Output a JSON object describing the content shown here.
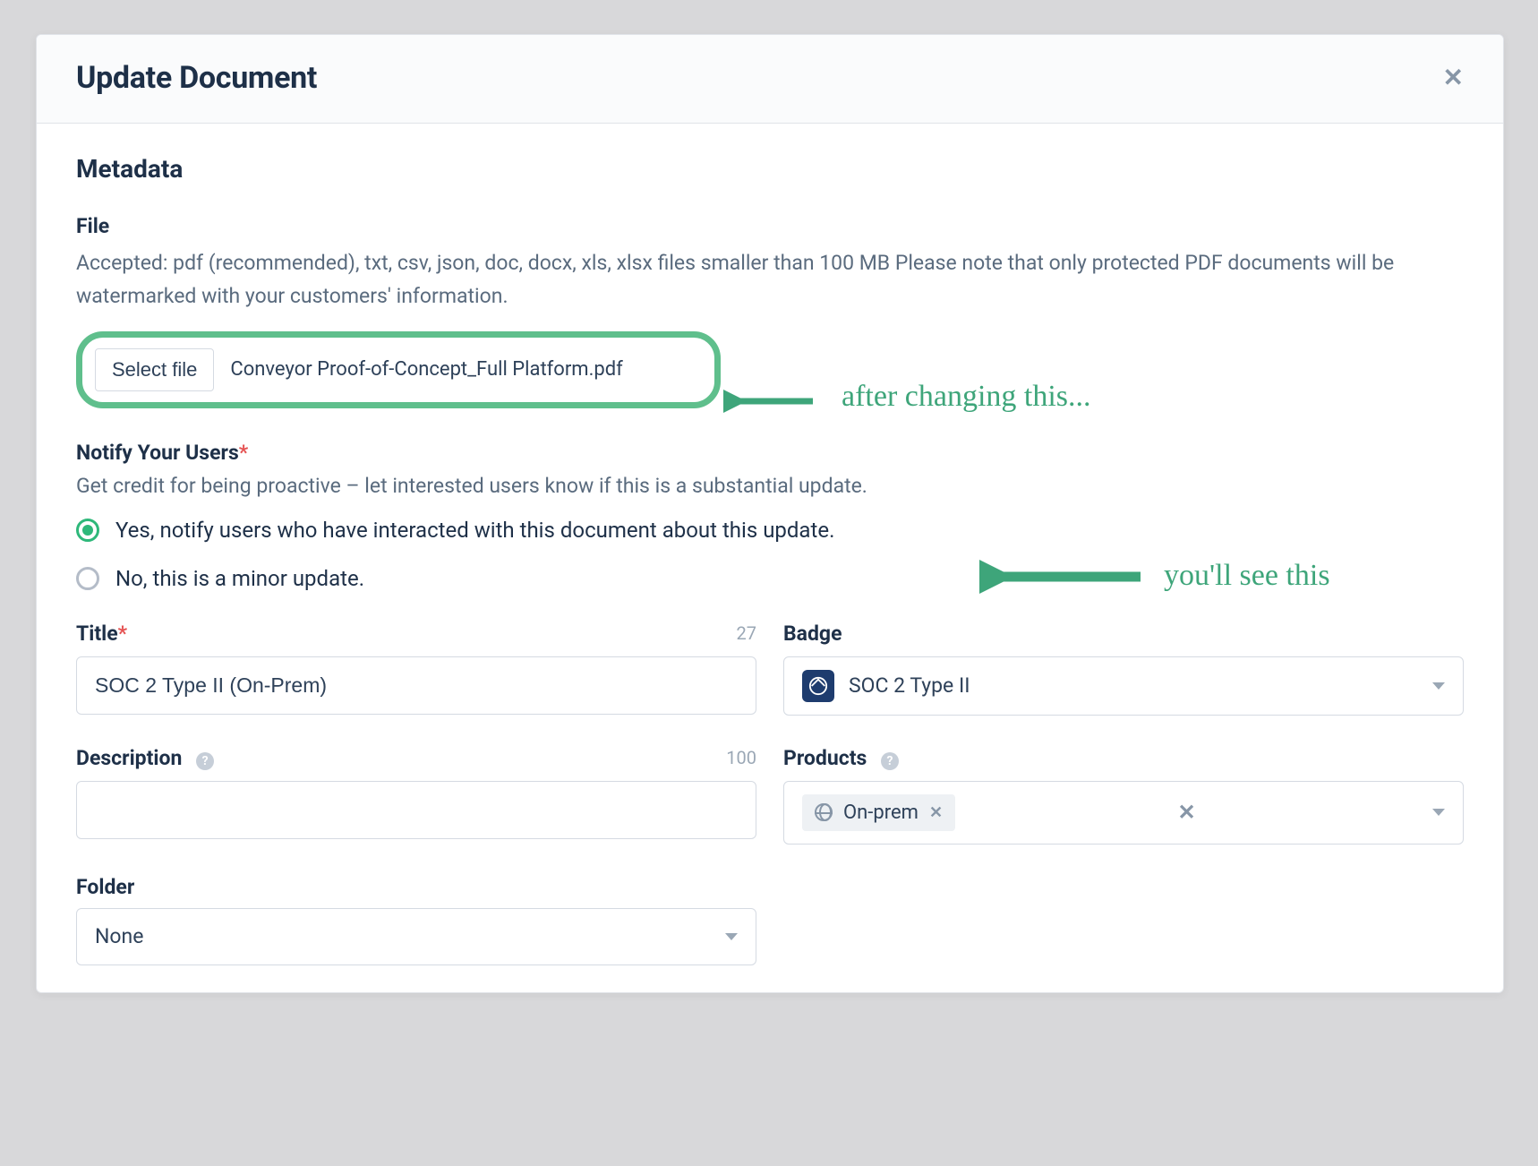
{
  "modal": {
    "title": "Update Document",
    "section_metadata": "Metadata",
    "file": {
      "label": "File",
      "help": "Accepted: pdf (recommended), txt, csv, json, doc, docx, xls, xlsx files smaller than 100 MB Please note that only protected PDF documents will be watermarked with your customers' information.",
      "select_btn": "Select file",
      "filename": "Conveyor Proof-of-Concept_Full Platform.pdf"
    },
    "notify": {
      "label": "Notify Your Users",
      "desc": "Get credit for being proactive – let interested users know if this is a substantial update.",
      "opt_yes": "Yes, notify users who have interacted with this document about this update.",
      "opt_no": "No, this is a minor update."
    },
    "title_field": {
      "label": "Title",
      "count": "27",
      "value": "SOC 2 Type II (On-Prem)"
    },
    "badge": {
      "label": "Badge",
      "value": "SOC 2 Type II"
    },
    "description": {
      "label": "Description",
      "count": "100",
      "value": ""
    },
    "products": {
      "label": "Products",
      "tag": "On-prem"
    },
    "folder": {
      "label": "Folder",
      "value": "None"
    }
  },
  "annotations": {
    "a1": "after changing this...",
    "a2": "you'll see this"
  }
}
